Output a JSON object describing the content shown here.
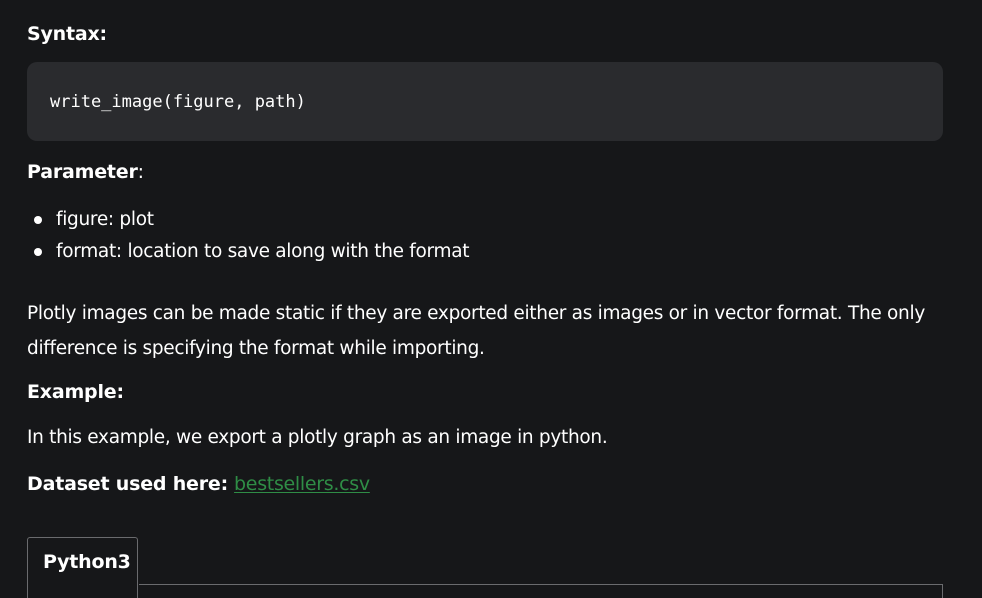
{
  "syntax": {
    "heading": "Syntax:",
    "code": "write_image(figure, path)"
  },
  "parameter": {
    "heading": "Parameter",
    "colon": ":",
    "items": [
      "figure: plot",
      "format: location to save along with the format"
    ]
  },
  "description": "Plotly images can be made static if they are exported either as images or in vector format. The only difference is specifying the format while importing.",
  "example": {
    "heading": "Example:",
    "text": "In this example, we export a plotly graph as an image in python."
  },
  "dataset": {
    "label": "Dataset used here:",
    "link_text": "bestsellers.csv",
    "link_color": "#2f8d46"
  },
  "code_tabs": {
    "active_tab": "Python3"
  },
  "colors": {
    "background": "#161719",
    "code_background": "#2a2b2e",
    "text": "#ffffff"
  }
}
